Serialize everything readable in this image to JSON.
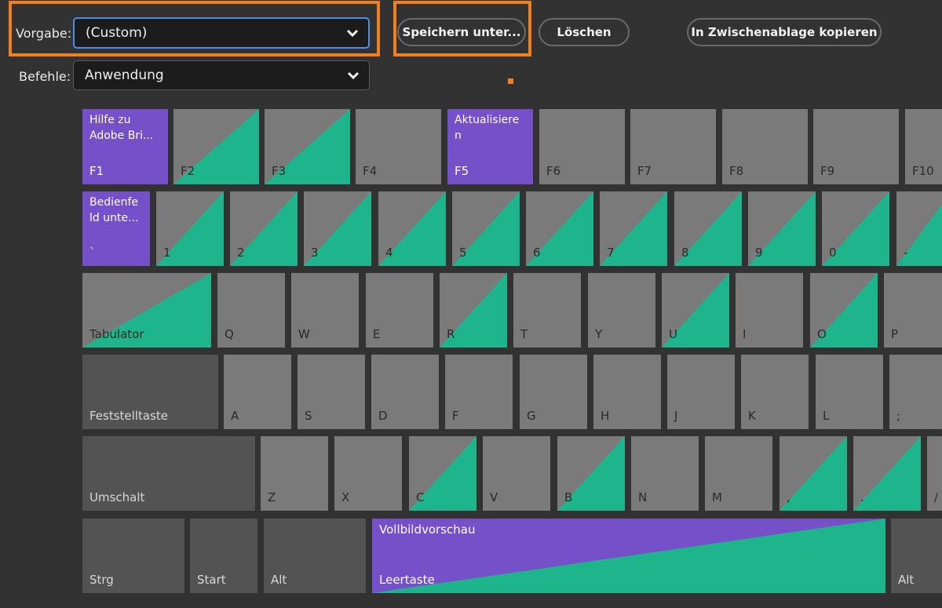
{
  "header": {
    "preset_label": "Vorgabe:",
    "preset_value": "(Custom)",
    "commands_label": "Befehle:",
    "commands_value": "Anwendung",
    "save_as_label": "Speichern unter...",
    "delete_label": "Löschen",
    "copy_clipboard_label": "In Zwischenablage kopieren"
  },
  "colors": {
    "background": "#323232",
    "key_gray": "#7a7a7a",
    "key_dark": "#535353",
    "assigned_purple": "#7550c8",
    "modifier_teal": "#1fb58c",
    "highlight_orange": "#f0801c"
  },
  "keyboard": {
    "row_fn": {
      "f1": {
        "label": "F1",
        "command": "Hilfe zu Adobe Bri..."
      },
      "f2": {
        "label": "F2"
      },
      "f3": {
        "label": "F3"
      },
      "f4": {
        "label": "F4"
      },
      "f5": {
        "label": "F5",
        "command": "Aktualisiere n"
      },
      "f6": {
        "label": "F6"
      },
      "f7": {
        "label": "F7"
      },
      "f8": {
        "label": "F8"
      },
      "f9": {
        "label": "F9"
      },
      "f10": {
        "label": "F10"
      }
    },
    "row_num": {
      "backtick": {
        "label": "`",
        "command": "Bedienfe ld unte..."
      },
      "k1": {
        "label": "1"
      },
      "k2": {
        "label": "2"
      },
      "k3": {
        "label": "3"
      },
      "k4": {
        "label": "4"
      },
      "k5": {
        "label": "5"
      },
      "k6": {
        "label": "6"
      },
      "k7": {
        "label": "7"
      },
      "k8": {
        "label": "8"
      },
      "k9": {
        "label": "9"
      },
      "k0": {
        "label": "0"
      },
      "minus": {
        "label": "-"
      }
    },
    "row_q": {
      "tab": {
        "label": "Tabulator"
      },
      "q": {
        "label": "Q"
      },
      "w": {
        "label": "W"
      },
      "e": {
        "label": "E"
      },
      "r": {
        "label": "R"
      },
      "t": {
        "label": "T"
      },
      "y": {
        "label": "Y"
      },
      "u": {
        "label": "U"
      },
      "i": {
        "label": "I"
      },
      "o": {
        "label": "O"
      },
      "p": {
        "label": "P"
      }
    },
    "row_a": {
      "caps": {
        "label": "Feststelltaste"
      },
      "a": {
        "label": "A"
      },
      "s": {
        "label": "S"
      },
      "d": {
        "label": "D"
      },
      "f": {
        "label": "F"
      },
      "g": {
        "label": "G"
      },
      "h": {
        "label": "H"
      },
      "j": {
        "label": "J"
      },
      "k": {
        "label": "K"
      },
      "l": {
        "label": "L"
      },
      "semicolon": {
        "label": ";"
      }
    },
    "row_z": {
      "shift": {
        "label": "Umschalt"
      },
      "z": {
        "label": "Z"
      },
      "x": {
        "label": "X"
      },
      "c": {
        "label": "C"
      },
      "v": {
        "label": "V"
      },
      "b": {
        "label": "B"
      },
      "n": {
        "label": "N"
      },
      "m": {
        "label": "M"
      },
      "comma": {
        "label": ","
      },
      "period": {
        "label": "."
      },
      "slash": {
        "label": "/"
      }
    },
    "row_bottom": {
      "ctrl": {
        "label": "Strg"
      },
      "start": {
        "label": "Start"
      },
      "alt_left": {
        "label": "Alt"
      },
      "space": {
        "label": "Leertaste",
        "command": "Vollbildvorschau"
      },
      "alt_right": {
        "label": "Alt"
      }
    }
  }
}
